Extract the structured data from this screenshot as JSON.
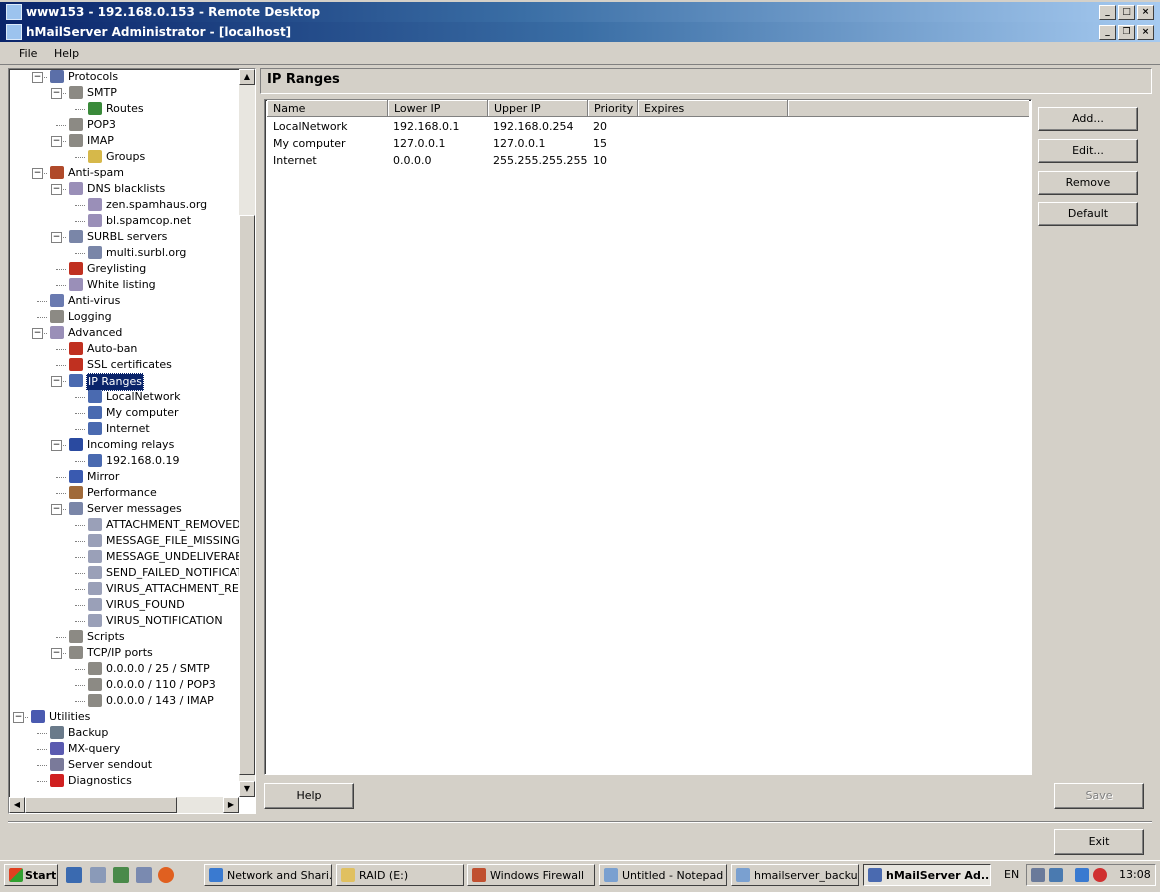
{
  "rd_window": {
    "title": "www153 - 192.168.0.153 - Remote Desktop"
  },
  "app_window": {
    "title": "hMailServer Administrator - [localhost]"
  },
  "window_buttons": {
    "minimize": "_",
    "maximize": "□",
    "restore": "❐",
    "close": "×"
  },
  "menu": [
    {
      "label": "File"
    },
    {
      "label": "Help"
    }
  ],
  "tree": {
    "items": [
      {
        "label": "Protocols",
        "icon": "protocols-icon",
        "color": "#5b6fa8"
      },
      {
        "label": "SMTP",
        "icon": "smtp-icon",
        "color": "#8c8a84"
      },
      {
        "label": "Routes",
        "icon": "routes-icon",
        "color": "#3a8a3a"
      },
      {
        "label": "POP3",
        "icon": "pop3-icon",
        "color": "#8c8a84"
      },
      {
        "label": "IMAP",
        "icon": "imap-icon",
        "color": "#8c8a84"
      },
      {
        "label": "Groups",
        "icon": "groups-icon",
        "color": "#d6b84a"
      },
      {
        "label": "Anti-spam",
        "icon": "anti-spam-icon",
        "color": "#b04a2a"
      },
      {
        "label": "DNS blacklists",
        "icon": "dns-blacklists-icon",
        "color": "#9a8fb8"
      },
      {
        "label": "zen.spamhaus.org",
        "icon": "blacklist-entry-icon",
        "color": "#9a8fb8"
      },
      {
        "label": "bl.spamcop.net",
        "icon": "blacklist-entry-icon",
        "color": "#9a8fb8"
      },
      {
        "label": "SURBL servers",
        "icon": "surbl-icon",
        "color": "#7a86a8"
      },
      {
        "label": "multi.surbl.org",
        "icon": "surbl-entry-icon",
        "color": "#7a86a8"
      },
      {
        "label": "Greylisting",
        "icon": "greylisting-icon",
        "color": "#c03020"
      },
      {
        "label": "White listing",
        "icon": "white-listing-icon",
        "color": "#9a8fb8"
      },
      {
        "label": "Anti-virus",
        "icon": "anti-virus-icon",
        "color": "#6a7ab0"
      },
      {
        "label": "Logging",
        "icon": "logging-icon",
        "color": "#8c8a84"
      },
      {
        "label": "Advanced",
        "icon": "advanced-icon",
        "color": "#9a8fb8"
      },
      {
        "label": "Auto-ban",
        "icon": "auto-ban-icon",
        "color": "#c03020"
      },
      {
        "label": "SSL certificates",
        "icon": "ssl-certificate-icon",
        "color": "#c03020"
      },
      {
        "label": "IP Ranges",
        "icon": "ip-ranges-icon",
        "color": "#4a6ab0"
      },
      {
        "label": "LocalNetwork",
        "icon": "ip-range-icon",
        "color": "#4a6ab0"
      },
      {
        "label": "My computer",
        "icon": "ip-range-icon",
        "color": "#4a6ab0"
      },
      {
        "label": "Internet",
        "icon": "ip-range-icon",
        "color": "#4a6ab0"
      },
      {
        "label": "Incoming relays",
        "icon": "incoming-relays-icon",
        "color": "#2a4aa0"
      },
      {
        "label": "192.168.0.19",
        "icon": "relay-entry-icon",
        "color": "#4a6ab0"
      },
      {
        "label": "Mirror",
        "icon": "mirror-icon",
        "color": "#3a5ab0"
      },
      {
        "label": "Performance",
        "icon": "performance-icon",
        "color": "#a06a3a"
      },
      {
        "label": "Server messages",
        "icon": "server-messages-icon",
        "color": "#7a86a8"
      },
      {
        "label": "ATTACHMENT_REMOVED",
        "icon": "message-icon",
        "color": "#9aa0b8"
      },
      {
        "label": "MESSAGE_FILE_MISSING",
        "icon": "message-icon",
        "color": "#9aa0b8"
      },
      {
        "label": "MESSAGE_UNDELIVERABLE",
        "icon": "message-icon",
        "color": "#9aa0b8"
      },
      {
        "label": "SEND_FAILED_NOTIFICATION",
        "icon": "message-icon",
        "color": "#9aa0b8"
      },
      {
        "label": "VIRUS_ATTACHMENT_REMOVED",
        "icon": "message-icon",
        "color": "#9aa0b8"
      },
      {
        "label": "VIRUS_FOUND",
        "icon": "message-icon",
        "color": "#9aa0b8"
      },
      {
        "label": "VIRUS_NOTIFICATION",
        "icon": "message-icon",
        "color": "#9aa0b8"
      },
      {
        "label": "Scripts",
        "icon": "scripts-icon",
        "color": "#8c8a84"
      },
      {
        "label": "TCP/IP ports",
        "icon": "tcpip-ports-icon",
        "color": "#8c8a84"
      },
      {
        "label": "0.0.0.0 / 25 / SMTP",
        "icon": "port-icon",
        "color": "#8c8a84"
      },
      {
        "label": "0.0.0.0 / 110 / POP3",
        "icon": "port-icon",
        "color": "#8c8a84"
      },
      {
        "label": "0.0.0.0 / 143 / IMAP",
        "icon": "port-icon",
        "color": "#8c8a84"
      },
      {
        "label": "Utilities",
        "icon": "utilities-icon",
        "color": "#4a5ab0"
      },
      {
        "label": "Backup",
        "icon": "backup-icon",
        "color": "#6a7a8a"
      },
      {
        "label": "MX-query",
        "icon": "mx-query-icon",
        "color": "#5a5ab0"
      },
      {
        "label": "Server sendout",
        "icon": "server-sendout-icon",
        "color": "#7a7a9a"
      },
      {
        "label": "Diagnostics",
        "icon": "diagnostics-icon",
        "color": "#d02020"
      }
    ]
  },
  "page": {
    "title": "IP Ranges"
  },
  "list": {
    "columns": [
      "Name",
      "Lower IP",
      "Upper IP",
      "Priority",
      "Expires"
    ],
    "rows": [
      [
        "LocalNetwork",
        "192.168.0.1",
        "192.168.0.254",
        "20",
        ""
      ],
      [
        "My computer",
        "127.0.0.1",
        "127.0.0.1",
        "15",
        ""
      ],
      [
        "Internet",
        "0.0.0.0",
        "255.255.255.255",
        "10",
        ""
      ]
    ]
  },
  "buttons": {
    "add": "Add...",
    "edit": "Edit...",
    "remove": "Remove",
    "default": "Default",
    "help": "Help",
    "save": "Save",
    "exit": "Exit"
  },
  "taskbar": {
    "start": "Start",
    "tasks": [
      {
        "label": "Network and Shari...",
        "icon": "network-sharing-icon",
        "color": "#3a7ad0"
      },
      {
        "label": "RAID (E:)",
        "icon": "folder-icon",
        "color": "#e0c060"
      },
      {
        "label": "Windows Firewall",
        "icon": "firewall-icon",
        "color": "#c05030"
      },
      {
        "label": "Untitled - Notepad",
        "icon": "notepad-icon",
        "color": "#7aa0d0"
      },
      {
        "label": "hmailserver_backu...",
        "icon": "notepad-icon",
        "color": "#7aa0d0"
      },
      {
        "label": "hMailServer Ad...",
        "icon": "hmailserver-icon",
        "color": "#4a6ab0",
        "active": true
      }
    ],
    "language": "EN",
    "clock": "13:08"
  }
}
